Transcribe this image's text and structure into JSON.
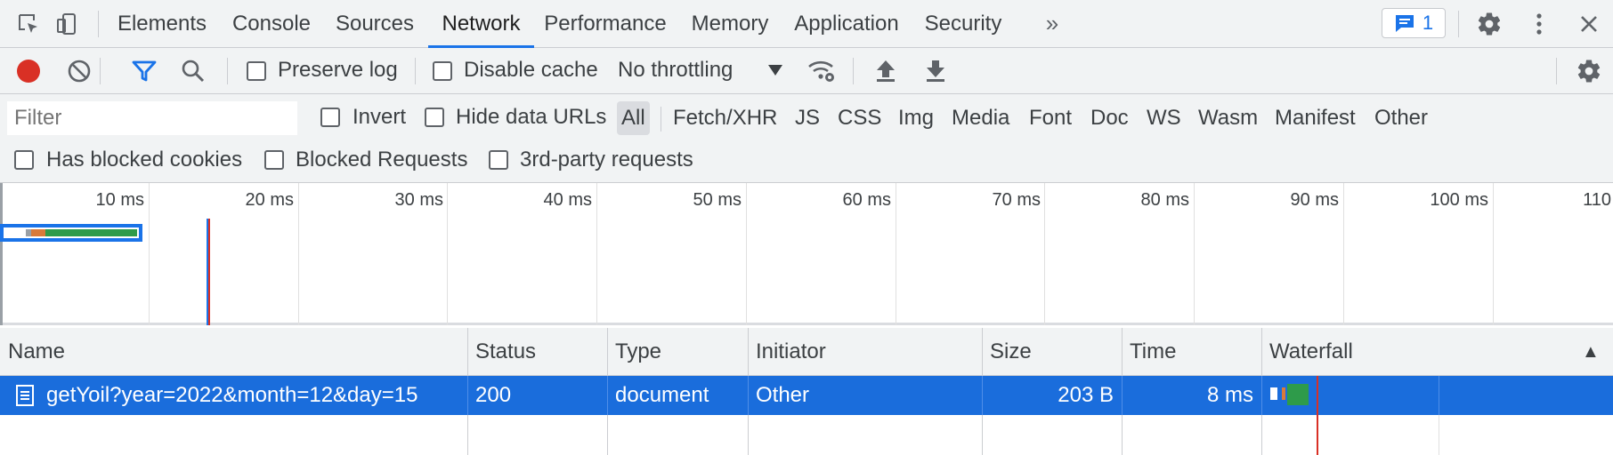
{
  "tabs": [
    {
      "label": "Elements"
    },
    {
      "label": "Console"
    },
    {
      "label": "Sources"
    },
    {
      "label": "Network"
    },
    {
      "label": "Performance"
    },
    {
      "label": "Memory"
    },
    {
      "label": "Application"
    },
    {
      "label": "Security"
    }
  ],
  "active_tab": "Network",
  "more_tabs_glyph": "»",
  "issues_count": "1",
  "toolbar": {
    "preserve_log_label": "Preserve log",
    "disable_cache_label": "Disable cache",
    "throttling_value": "No throttling"
  },
  "filter": {
    "placeholder": "Filter",
    "invert_label": "Invert",
    "hide_data_urls_label": "Hide data URLs",
    "types": [
      "All",
      "Fetch/XHR",
      "JS",
      "CSS",
      "Img",
      "Media",
      "Font",
      "Doc",
      "WS",
      "Wasm",
      "Manifest",
      "Other"
    ],
    "has_blocked_cookies_label": "Has blocked cookies",
    "blocked_requests_label": "Blocked Requests",
    "third_party_label": "3rd-party requests"
  },
  "overview": {
    "ticks": [
      "10 ms",
      "20 ms",
      "30 ms",
      "40 ms",
      "50 ms",
      "60 ms",
      "70 ms",
      "80 ms",
      "90 ms",
      "100 ms",
      "110"
    ]
  },
  "table": {
    "columns": [
      "Name",
      "Status",
      "Type",
      "Initiator",
      "Size",
      "Time",
      "Waterfall"
    ],
    "sort_glyph": "▲",
    "rows": [
      {
        "name": "getYoil?year=2022&month=12&day=15",
        "status": "200",
        "type": "document",
        "initiator": "Other",
        "size": "203 B",
        "time": "8 ms"
      }
    ]
  },
  "colors": {
    "accent": "#1a73e8",
    "record": "#d93025",
    "selected_row": "#1a6ddc",
    "bar_waiting": "#2e9b4a",
    "bar_queue": "#d97a3a"
  }
}
